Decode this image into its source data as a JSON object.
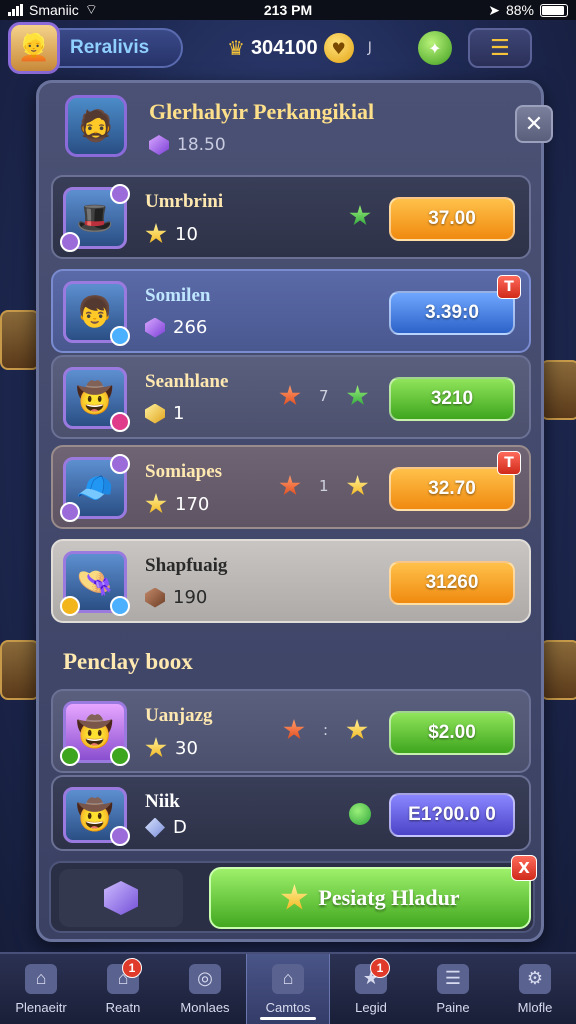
{
  "status": {
    "carrier": "Smaniic",
    "time": "213 PM",
    "battery": "88%"
  },
  "top": {
    "player_name": "Reralivis",
    "gold": "304100",
    "small_label": "J"
  },
  "modal": {
    "title": "Glerhalyir Perkangikial",
    "subtitle_value": "18.50",
    "close_label": "✕",
    "rows": [
      {
        "name": "Umrbrini",
        "value": "10",
        "mid_label": "",
        "price": "37.00",
        "badge": ""
      },
      {
        "name": "Somilen",
        "value": "266",
        "mid_label": "",
        "price": "3.39:0",
        "badge": "T"
      },
      {
        "name": "Seanhlane",
        "value": "1",
        "mid_label": "7",
        "price": "3210",
        "badge": ""
      },
      {
        "name": "Somiapes",
        "value": "170",
        "mid_label": "1",
        "price": "32.70",
        "badge": "T"
      },
      {
        "name": "Shapfuaig",
        "value": "190",
        "mid_label": "",
        "price": "31260",
        "badge": ""
      }
    ],
    "section_title": "Penclay boox",
    "section_rows": [
      {
        "name": "Uanjazg",
        "value": "30",
        "mid_label": ":",
        "price": "$2.00"
      },
      {
        "name": "Niik",
        "value": "D",
        "mid_label": "",
        "price": "E1?00.0 0"
      }
    ],
    "action_label": "Pesiatg Hladur",
    "action_badge": "X"
  },
  "nav": [
    {
      "label": "Plenaeitr",
      "badge": ""
    },
    {
      "label": "Reatn",
      "badge": "1"
    },
    {
      "label": "Monlaes",
      "badge": ""
    },
    {
      "label": "Camtos",
      "badge": ""
    },
    {
      "label": "Legid",
      "badge": "1"
    },
    {
      "label": "Paine",
      "badge": ""
    },
    {
      "label": "Mlofle",
      "badge": ""
    }
  ],
  "colors": {
    "accent": "#ffe08a",
    "primary_green": "#42a820",
    "orange": "#f08a10",
    "blue": "#2d62c8"
  }
}
